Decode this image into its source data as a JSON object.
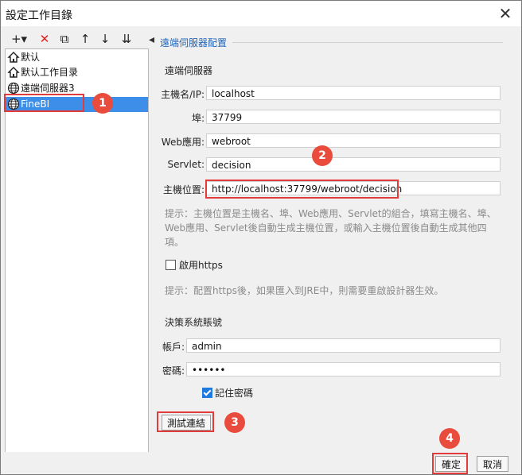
{
  "window": {
    "title": "設定工作目錄",
    "close": "✕"
  },
  "toolbar": {
    "add": "+▾",
    "delete": "✕",
    "copy": "⧉",
    "up": "↑",
    "down": "↓",
    "move": "⇊"
  },
  "tree": [
    {
      "label": "默认",
      "icon": "house-icon"
    },
    {
      "label": "默认工作目录",
      "icon": "house-icon"
    },
    {
      "label": "遠端伺服器3",
      "icon": "globe-icon"
    },
    {
      "label": "FineBI",
      "icon": "globe-icon"
    }
  ],
  "panel": {
    "title": "遠端伺服器配置",
    "server_section": "遠端伺服器",
    "host_label": "主機名/IP:",
    "host_value": "localhost",
    "port_label": "埠:",
    "port_value": "37799",
    "web_label": "Web應用:",
    "web_value": "webroot",
    "servlet_label": "Servlet:",
    "servlet_value": "decision",
    "location_label": "主機位置:",
    "location_value": "http://localhost:37799/webroot/decision",
    "hint1_line1": "提示：主機位置是主機名、埠、Web應用、Servlet的組合，填寫主機名、埠、",
    "hint1_line2": "Web應用、Servlet後自動生成主機位置，或輸入主機位置後自動生成其他四",
    "hint1_line3": "項。",
    "https_label": "啟用https",
    "hint2": "提示：配置https後，如果匯入到JRE中，則需要重啟設計器生效。",
    "account_section": "決策系統賬號",
    "account_label": "帳戶:",
    "account_value": "admin",
    "password_label": "密碼:",
    "password_value": "••••••",
    "remember_label": "記住密碼",
    "test_button": "測試連結"
  },
  "footer": {
    "ok": "確定",
    "cancel": "取消"
  },
  "annotations": [
    "1",
    "2",
    "3",
    "4"
  ],
  "state": {
    "https_checked": false,
    "remember_checked": true,
    "selected_tree_index": 3
  },
  "colors": {
    "accent": "#3d8ee8",
    "highlight": "#e23b3b",
    "section_title": "#1f64b8"
  }
}
